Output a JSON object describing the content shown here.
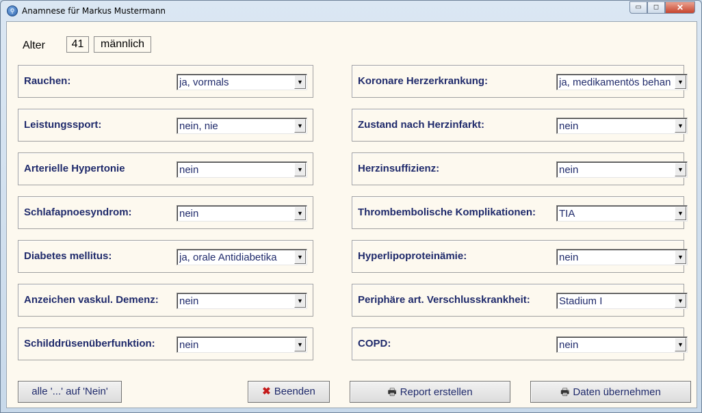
{
  "window": {
    "title": "Anamnese für Markus Mustermann",
    "minimize": "▭",
    "maximize": "◻",
    "close": "✕"
  },
  "alter": {
    "label": "Alter",
    "age": "41",
    "sex": "männlich"
  },
  "left": [
    {
      "label": "Rauchen:",
      "value": "ja, vormals"
    },
    {
      "label": "Leistungssport:",
      "value": "nein, nie"
    },
    {
      "label": "Arterielle Hypertonie",
      "value": "nein"
    },
    {
      "label": "Schlafapnoesyndrom:",
      "value": "nein"
    },
    {
      "label": "Diabetes mellitus:",
      "value": "ja, orale Antidiabetika"
    },
    {
      "label": "Anzeichen vaskul. Demenz:",
      "value": "nein"
    },
    {
      "label": "Schilddrüsenüberfunktion:",
      "value": "nein"
    }
  ],
  "right": [
    {
      "label": "Koronare Herzerkrankung:",
      "value": "ja, medikamentös behan"
    },
    {
      "label": "Zustand nach Herzinfarkt:",
      "value": "nein"
    },
    {
      "label": "Herzinsuffizienz:",
      "value": "nein"
    },
    {
      "label": "Thrombembolische Komplikationen:",
      "value": "TIA"
    },
    {
      "label": "Hyperlipoproteinämie:",
      "value": "nein"
    },
    {
      "label": "Periphäre art. Verschlusskrankheit:",
      "value": "Stadium I"
    },
    {
      "label": "COPD:",
      "value": "nein"
    }
  ],
  "buttons": {
    "all_no": "alle '...' auf 'Nein'",
    "end": "Beenden",
    "report": "Report erstellen",
    "apply": "Daten übernehmen"
  }
}
